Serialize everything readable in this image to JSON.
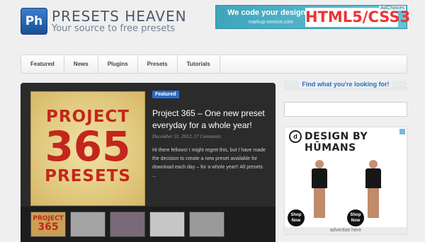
{
  "header": {
    "logo_text": "Ph",
    "title": "PRESETS HEAVEN",
    "tagline": "Your source to free presets"
  },
  "top_ad": {
    "headline": "We code your design to",
    "subline": "markup-service.com",
    "highlight": "HTML5/CSS3",
    "choices": "AdChoices"
  },
  "nav": {
    "items": [
      {
        "label": "Featured"
      },
      {
        "label": "News"
      },
      {
        "label": "Plugins"
      },
      {
        "label": "Presets"
      },
      {
        "label": "Tutorials"
      }
    ]
  },
  "featured": {
    "image_text": {
      "line1": "PROJECT",
      "line2": "365",
      "line3": "PRESETS"
    },
    "badge": "Featured",
    "title": "Project 365 – One new preset everyday for a whole year!",
    "meta": "December 31, 2012, 17 Comments",
    "excerpt": "Hi there fellows! I might regret this, but I have made the decision to create a new preset available for download each day – for a whole year!! All presets ...",
    "thumbs": [
      {
        "name": "project-365",
        "color": "#c9a055"
      },
      {
        "name": "grid-photos",
        "color": "#a4a4a4"
      },
      {
        "name": "portrait",
        "color": "#7a6a78"
      },
      {
        "name": "still-life",
        "color": "#c6c6c6"
      },
      {
        "name": "gray",
        "color": "#9a9a9a"
      }
    ]
  },
  "sidebar": {
    "find_title": "Find what you're looking for!",
    "search_placeholder": "",
    "ad": {
      "logo": "d",
      "brand": "DESIGN BY HŪMANS",
      "shop_now": "Shop Now",
      "advertise": "advertise here"
    }
  }
}
